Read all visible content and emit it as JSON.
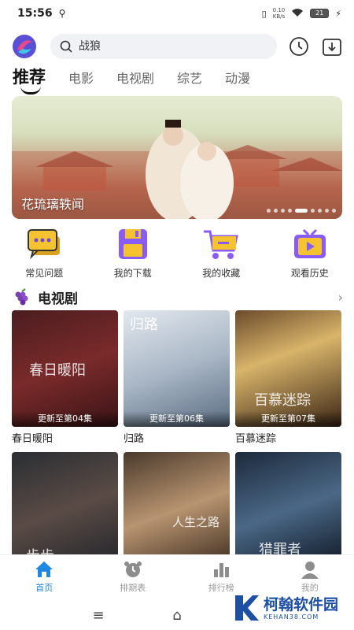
{
  "status_bar": {
    "time": "15:56",
    "usb_icon": "usb-icon",
    "net_speed_value": "0.10",
    "net_speed_unit": "KB/s",
    "battery": "21"
  },
  "search": {
    "placeholder": "战狼"
  },
  "tabs": [
    {
      "label": "推荐",
      "active": true
    },
    {
      "label": "电影"
    },
    {
      "label": "电视剧"
    },
    {
      "label": "综艺"
    },
    {
      "label": "动漫"
    }
  ],
  "banner": {
    "title": "花琉璃轶闻",
    "dot_count": 9,
    "active_dot": 4
  },
  "quick_links": [
    {
      "label": "常见问题",
      "icon": "chat-bubble-icon"
    },
    {
      "label": "我的下载",
      "icon": "floppy-disk-icon"
    },
    {
      "label": "我的收藏",
      "icon": "shopping-cart-icon"
    },
    {
      "label": "观看历史",
      "icon": "tv-play-icon"
    }
  ],
  "section": {
    "title": "电视剧",
    "icon": "grapes-icon",
    "more_icon": "chevron-right-icon",
    "more": "›"
  },
  "cards": [
    {
      "title": "春日暖阳",
      "badge": "更新至第04集",
      "poster_text": "春日暖阳"
    },
    {
      "title": "归路",
      "badge": "更新至第06集",
      "poster_text": "归路"
    },
    {
      "title": "百慕迷踪",
      "badge": "更新至第07集",
      "poster_text": "百慕迷踪"
    },
    {
      "title": "",
      "badge": "",
      "poster_text": "步步"
    },
    {
      "title": "",
      "badge": "",
      "poster_text": "人生之路"
    },
    {
      "title": "",
      "badge": "",
      "poster_text": "猎罪者"
    }
  ],
  "bottom_nav": [
    {
      "label": "首页",
      "icon": "home-icon",
      "active": true
    },
    {
      "label": "排期表",
      "icon": "alarm-clock-icon"
    },
    {
      "label": "排行榜",
      "icon": "bar-chart-icon"
    },
    {
      "label": "我的",
      "icon": "user-icon"
    }
  ],
  "system_nav": {
    "menu": "≡",
    "home": "⌂"
  },
  "watermark": {
    "name": "柯翰软件园",
    "sub": "KEHAN38.COM"
  },
  "colors": {
    "accent": "#1e88e5",
    "quick_icon_yellow": "#f5c230",
    "quick_icon_purple": "#8a5cf6"
  }
}
